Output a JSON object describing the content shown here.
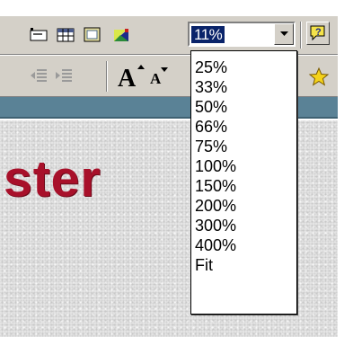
{
  "toolbar": {
    "zoom": {
      "value": "11%",
      "options": [
        "25%",
        "33%",
        "50%",
        "66%",
        "75%",
        "100%",
        "150%",
        "200%",
        "300%",
        "400%",
        "Fit"
      ]
    },
    "icons": {
      "row1": [
        "insert-frame-icon",
        "table-icon",
        "bordered-box-icon",
        "color-palette-icon",
        "help-icon"
      ],
      "row2": [
        "decrease-indent-icon",
        "increase-indent-icon",
        "grow-font-icon",
        "shrink-font-icon",
        "design-gallery-icon"
      ]
    }
  },
  "document": {
    "visible_text": "ster",
    "text_color": "#a8102a"
  },
  "colors": {
    "toolbar": "#d4d0c8",
    "band": "#5a8296",
    "selection": "#0a246a"
  }
}
